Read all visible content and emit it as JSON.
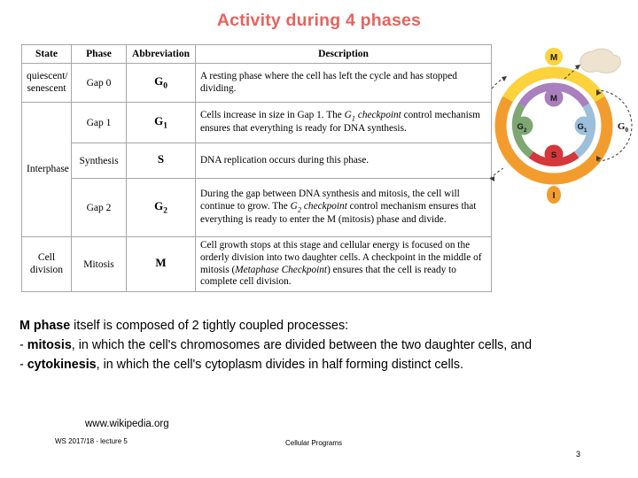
{
  "slide": {
    "title": "Activity during 4 phases",
    "page_number": "3"
  },
  "table": {
    "headers": {
      "state": "State",
      "phase": "Phase",
      "abbreviation": "Abbreviation",
      "description": "Description"
    },
    "rows": [
      {
        "state": "quiescent/ senescent",
        "phase": "Gap 0",
        "abbr_base": "G",
        "abbr_sub": "0",
        "description": "A resting phase where the cell has left the cycle and has stopped dividing."
      },
      {
        "state": "Interphase",
        "phase": "Gap 1",
        "abbr_base": "G",
        "abbr_sub": "1",
        "description": "Cells increase in size in Gap 1. The G1 checkpoint control mechanism ensures that everything is ready for DNA synthesis."
      },
      {
        "state": "",
        "phase": "Synthesis",
        "abbr_base": "S",
        "abbr_sub": "",
        "description": "DNA replication occurs during this phase."
      },
      {
        "state": "",
        "phase": "Gap 2",
        "abbr_base": "G",
        "abbr_sub": "2",
        "description": "During the gap between DNA synthesis and mitosis, the cell will continue to grow. The G2 checkpoint control mechanism ensures that everything is ready to enter the M (mitosis) phase and divide."
      },
      {
        "state": "Cell division",
        "phase": "Mitosis",
        "abbr_base": "M",
        "abbr_sub": "",
        "description": "Cell growth stops at this stage and cellular energy is focused on the orderly division into two daughter cells. A checkpoint in the middle of mitosis (Metaphase Checkpoint) ensures that the cell is ready to complete cell division."
      }
    ]
  },
  "diagram": {
    "name": "cell-cycle-diagram",
    "outer_label_top": "M",
    "outer_label_bottom": "I",
    "side_label": "G",
    "side_label_sub": "0",
    "inner_labels": {
      "mitosis": "M",
      "gap2": "G",
      "gap2_sub": "2",
      "gap1": "G",
      "gap1_sub": "1",
      "synthesis": "S"
    },
    "colors": {
      "outer_ring": "#F39C2E",
      "outer_m_segment": "#FDD23C",
      "inner_m": "#A97FBE",
      "inner_g2": "#7FA772",
      "inner_s": "#D6373A",
      "inner_g1": "#9CBFDB",
      "blob": "#EDE3CE"
    }
  },
  "body": {
    "line1_bold": "M phase",
    "line1_rest": " itself is composed of 2 tightly coupled processes:",
    "line2_prefix": "- ",
    "line2_bold": "mitosis",
    "line2_rest": ", in which the cell's chromosomes are divided between the two daughter cells, and",
    "line3_prefix": "- ",
    "line3_bold": "cytokinesis",
    "line3_rest": ", in which the cell's cytoplasm divides in half forming distinct cells."
  },
  "source": {
    "url": "www.wikipedia.org"
  },
  "footer": {
    "left": "WS 2017/18 - lecture 5",
    "center": "Cellular Programs"
  }
}
